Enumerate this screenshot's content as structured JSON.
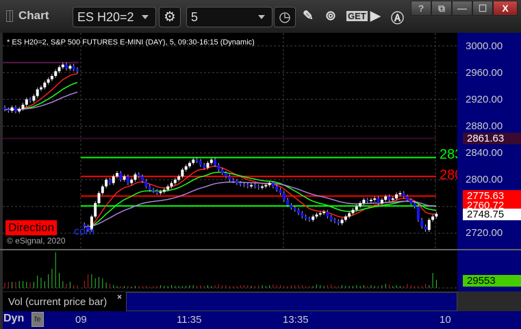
{
  "window": {
    "title": "Chart",
    "buttons": [
      "?",
      "⧉",
      "—",
      "☐",
      "X"
    ]
  },
  "toolbar": {
    "symbol": "ES H20=2",
    "interval": "5"
  },
  "chart": {
    "info": "* ES H20=2, S&P 500 FUTURES E-MINI (DAY), 5, 09:30-16:15 (Dynamic)",
    "copyright": "© eSignal, 2020",
    "watermark": "Direction",
    "watermark_suffix": "com",
    "level_labels": [
      {
        "text": "283",
        "color": "#00ff00"
      },
      {
        "text": "280",
        "color": "#ff0000"
      }
    ]
  },
  "price_axis": {
    "ticks": [
      "3000.00",
      "2960.00",
      "2920.00",
      "2880.00",
      "2840.00",
      "2800.00",
      "2720.00"
    ],
    "tags": [
      {
        "text": "2861.63",
        "bg": "#3a0a30",
        "fg": "#ffffff"
      },
      {
        "text": "2775.63",
        "bg": "#ff0000",
        "fg": "#ffffff"
      },
      {
        "text": "2760.72",
        "bg": "#ff0000",
        "fg": "#ffffff"
      },
      {
        "text": "2748.75",
        "bg": "#ffffff",
        "fg": "#000000"
      }
    ]
  },
  "volume": {
    "label": "Vol (current price bar)",
    "close": "×",
    "tag": "29553"
  },
  "time_axis": {
    "mode": "Dyn",
    "labels": [
      "09",
      "11:35",
      "13:35",
      "10"
    ]
  },
  "chart_data": {
    "type": "candlestick",
    "ylim": [
      2700,
      3010
    ],
    "closes": [
      2905,
      2903,
      2908,
      2902,
      2906,
      2912,
      2920,
      2918,
      2925,
      2935,
      2938,
      2945,
      2950,
      2955,
      2962,
      2968,
      2972,
      2966,
      2970,
      2965,
      2962,
      2730,
      2725,
      2745,
      2765,
      2780,
      2790,
      2800,
      2795,
      2805,
      2810,
      2800,
      2805,
      2795,
      2800,
      2808,
      2805,
      2798,
      2790,
      2785,
      2783,
      2780,
      2782,
      2785,
      2790,
      2795,
      2800,
      2805,
      2815,
      2820,
      2825,
      2830,
      2828,
      2822,
      2818,
      2825,
      2830,
      2822,
      2815,
      2810,
      2805,
      2800,
      2798,
      2795,
      2793,
      2792,
      2790,
      2792,
      2790,
      2788,
      2790,
      2792,
      2795,
      2790,
      2785,
      2780,
      2770,
      2762,
      2758,
      2755,
      2750,
      2745,
      2742,
      2740,
      2745,
      2748,
      2750,
      2752,
      2745,
      2740,
      2738,
      2735,
      2740,
      2745,
      2750,
      2755,
      2760,
      2765,
      2770,
      2768,
      2770,
      2772,
      2765,
      2770,
      2775,
      2770,
      2772,
      2778,
      2780,
      2775,
      2770,
      2765,
      2760,
      2740,
      2730,
      2725,
      2740,
      2745,
      2749
    ],
    "volumes": [
      8,
      9,
      9,
      9,
      10,
      10,
      9,
      8,
      9,
      18,
      15,
      10,
      20,
      28,
      52,
      22,
      10,
      6,
      9,
      4,
      4,
      10,
      20,
      20,
      14,
      16,
      14,
      8,
      6,
      4,
      3,
      3,
      3,
      3,
      2,
      3,
      3,
      3,
      3,
      2,
      3,
      3,
      4,
      3,
      3,
      4,
      3,
      3,
      3,
      3,
      4,
      4,
      3,
      4,
      3,
      4,
      3,
      4,
      5,
      4,
      4,
      3,
      3,
      3,
      4,
      4,
      4,
      3,
      3,
      4,
      4,
      3,
      4,
      5,
      4,
      4,
      3,
      3,
      4,
      4,
      4,
      4,
      3,
      3,
      3,
      5,
      4,
      3,
      4,
      5,
      3,
      3,
      4,
      3,
      3,
      3,
      4,
      3,
      4,
      3,
      4,
      3,
      3,
      4,
      6,
      5,
      3,
      4,
      3,
      3,
      6,
      4,
      3,
      3,
      3,
      6,
      4,
      22,
      12,
      9
    ],
    "levels": [
      {
        "price": 2861.63,
        "color": "#3a0a30"
      },
      {
        "price": 2833,
        "color": "#00ff00"
      },
      {
        "price": 2805,
        "color": "#ff0000"
      },
      {
        "price": 2775.63,
        "color": "#ff0000"
      },
      {
        "price": 2760.72,
        "color": "#00ff00"
      }
    ]
  }
}
